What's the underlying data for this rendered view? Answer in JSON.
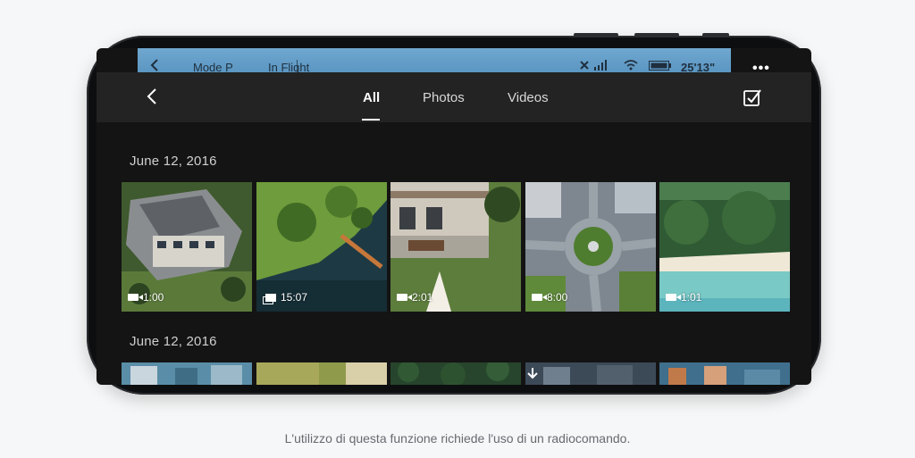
{
  "status_bar": {
    "back_icon": "chevron-left-icon",
    "mode": "Mode P",
    "flight_status": "In Flight",
    "icons": [
      "satellite-icon",
      "signal-icon",
      "wifi-icon",
      "battery-icon"
    ],
    "time": "25'13\""
  },
  "more_menu": {
    "label": "•••"
  },
  "nav": {
    "back_icon": "chevron-left-icon",
    "tabs": [
      {
        "label": "All",
        "active": true
      },
      {
        "label": "Photos",
        "active": false
      },
      {
        "label": "Videos",
        "active": false
      }
    ],
    "select_icon": "checkbox-select-icon"
  },
  "groups": [
    {
      "date": "June 12, 2016",
      "items": [
        {
          "type": "video",
          "duration": "1:00",
          "scene": "house-aerial"
        },
        {
          "type": "panorama",
          "duration": "15:07",
          "scene": "lake-pier"
        },
        {
          "type": "video",
          "duration": "2:01",
          "scene": "backyard"
        },
        {
          "type": "video",
          "duration": "8:00",
          "scene": "roundabout"
        },
        {
          "type": "video",
          "duration": "1:01",
          "scene": "beach"
        }
      ]
    },
    {
      "date": "June 12, 2016",
      "items": [
        {
          "type": "video",
          "scene": "city-blue"
        },
        {
          "type": "video",
          "scene": "field"
        },
        {
          "type": "video",
          "scene": "forest"
        },
        {
          "type": "video",
          "scene": "town"
        },
        {
          "type": "video",
          "scene": "coast"
        }
      ]
    }
  ],
  "colors": {
    "accent": "#ffffff",
    "status_bar": "#5b96c2",
    "screen_bg": "#141414"
  },
  "caption": "L'utilizzo di questa funzione richiede l'uso di un radiocomando."
}
